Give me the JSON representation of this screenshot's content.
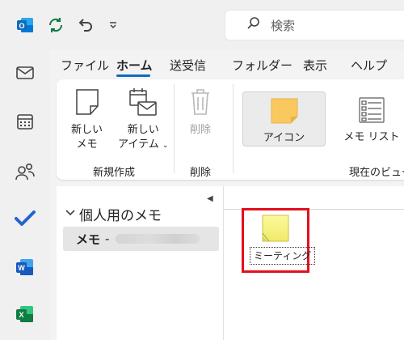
{
  "titlebar": {
    "search_label": "検索"
  },
  "ribbon_tabs": [
    {
      "label": "ファイル"
    },
    {
      "label": "ホーム"
    },
    {
      "label": "送受信"
    },
    {
      "label": "フォルダー"
    },
    {
      "label": "表示"
    },
    {
      "label": "ヘルプ"
    }
  ],
  "active_tab": "ホーム",
  "ribbon": {
    "new_note_label": "新しい\nメモ",
    "new_item_label": "新しい\nアイテム",
    "new_group_label": "新規作成",
    "delete_label": "削除",
    "delete_group_label": "削除",
    "icon_view_label": "アイコン",
    "list_view_label": "メモ リスト",
    "current_view_group_label": "現在のビュー"
  },
  "folder_pane": {
    "group_title": "個人用のメモ",
    "item_label": "メモ",
    "item_separator": "-"
  },
  "notes": [
    {
      "label": "ミーティング"
    }
  ],
  "colors": {
    "accent": "#0f6cbd",
    "highlight": "#e3101e",
    "note_yellow": "#f7f38f"
  }
}
